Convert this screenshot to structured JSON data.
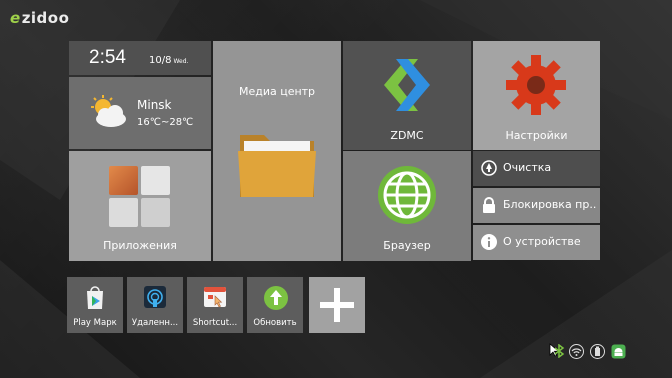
{
  "brand": {
    "logo_text": "zidoo"
  },
  "clock": {
    "time": "2:54",
    "date": "10/8",
    "day": "Wed."
  },
  "weather": {
    "city": "Minsk",
    "temp": "16℃~28℃"
  },
  "tiles": {
    "media": "Медиа центр",
    "zdmc": "ZDMC",
    "settings": "Настройки",
    "apps": "Приложения",
    "browser": "Браузер",
    "clean": "Очистка",
    "lock": "Блокировка пр...",
    "about": "О устройстве"
  },
  "shortcuts": [
    {
      "label": "Play Марк",
      "icon": "play-store-icon"
    },
    {
      "label": "Удаленн...",
      "icon": "remote-icon"
    },
    {
      "label": "Shortcut...",
      "icon": "shortcut-icon"
    },
    {
      "label": "Обновить",
      "icon": "update-icon"
    }
  ],
  "add_button": {
    "icon": "plus-icon"
  },
  "status_icons": [
    "bluetooth-icon",
    "wifi-icon",
    "usb-storage-icon",
    "android-icon"
  ],
  "colors": {
    "accent_green": "#7cc242",
    "settings_red": "#d8391a",
    "folder_orange": "#e0a43a"
  }
}
